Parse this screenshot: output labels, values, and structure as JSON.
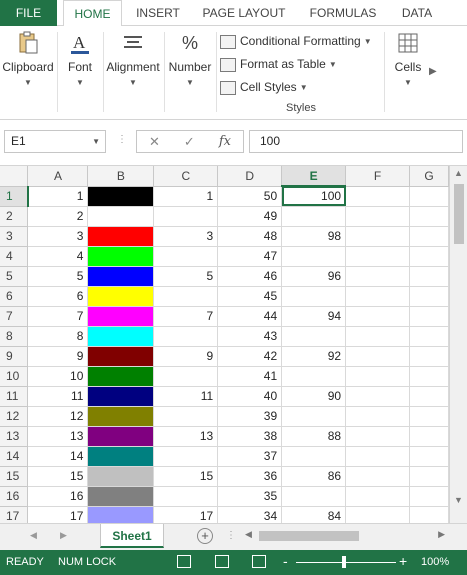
{
  "ribbon_tabs": [
    "FILE",
    "HOME",
    "INSERT",
    "PAGE LAYOUT",
    "FORMULAS",
    "DATA"
  ],
  "ribbon": {
    "clipboard": "Clipboard",
    "font": "Font",
    "alignment": "Alignment",
    "number": "Number",
    "conditional_formatting": "Conditional Formatting",
    "format_as_table": "Format as Table",
    "cell_styles": "Cell Styles",
    "styles_group": "Styles",
    "cells": "Cells"
  },
  "formula_bar": {
    "name_box": "E1",
    "formula": "100"
  },
  "columns": [
    "A",
    "B",
    "C",
    "D",
    "E",
    "F",
    "G"
  ],
  "selected_column": "E",
  "selected_row": "1",
  "rows": [
    {
      "row": "1",
      "a": "1",
      "b": "#000000",
      "c": "1",
      "d": "50",
      "e": "100"
    },
    {
      "row": "2",
      "a": "2",
      "b": "#FFFFFF",
      "c": "",
      "d": "49",
      "e": ""
    },
    {
      "row": "3",
      "a": "3",
      "b": "#FF0000",
      "c": "3",
      "d": "48",
      "e": "98"
    },
    {
      "row": "4",
      "a": "4",
      "b": "#00FF00",
      "c": "",
      "d": "47",
      "e": ""
    },
    {
      "row": "5",
      "a": "5",
      "b": "#0000FF",
      "c": "5",
      "d": "46",
      "e": "96"
    },
    {
      "row": "6",
      "a": "6",
      "b": "#FFFF00",
      "c": "",
      "d": "45",
      "e": ""
    },
    {
      "row": "7",
      "a": "7",
      "b": "#FF00FF",
      "c": "7",
      "d": "44",
      "e": "94"
    },
    {
      "row": "8",
      "a": "8",
      "b": "#00FFFF",
      "c": "",
      "d": "43",
      "e": ""
    },
    {
      "row": "9",
      "a": "9",
      "b": "#800000",
      "c": "9",
      "d": "42",
      "e": "92"
    },
    {
      "row": "10",
      "a": "10",
      "b": "#008000",
      "c": "",
      "d": "41",
      "e": ""
    },
    {
      "row": "11",
      "a": "11",
      "b": "#000080",
      "c": "11",
      "d": "40",
      "e": "90"
    },
    {
      "row": "12",
      "a": "12",
      "b": "#808000",
      "c": "",
      "d": "39",
      "e": ""
    },
    {
      "row": "13",
      "a": "13",
      "b": "#800080",
      "c": "13",
      "d": "38",
      "e": "88"
    },
    {
      "row": "14",
      "a": "14",
      "b": "#008080",
      "c": "",
      "d": "37",
      "e": ""
    },
    {
      "row": "15",
      "a": "15",
      "b": "#C0C0C0",
      "c": "15",
      "d": "36",
      "e": "86"
    },
    {
      "row": "16",
      "a": "16",
      "b": "#808080",
      "c": "",
      "d": "35",
      "e": ""
    },
    {
      "row": "17",
      "a": "17",
      "b": "#9999FF",
      "c": "17",
      "d": "34",
      "e": "84"
    }
  ],
  "sheet_tab": "Sheet1",
  "status": {
    "ready": "READY",
    "num_lock": "NUM LOCK",
    "zoom": "100%",
    "zoom_minus": "-",
    "zoom_plus": "+"
  },
  "colors": {
    "accent": "#217346"
  }
}
